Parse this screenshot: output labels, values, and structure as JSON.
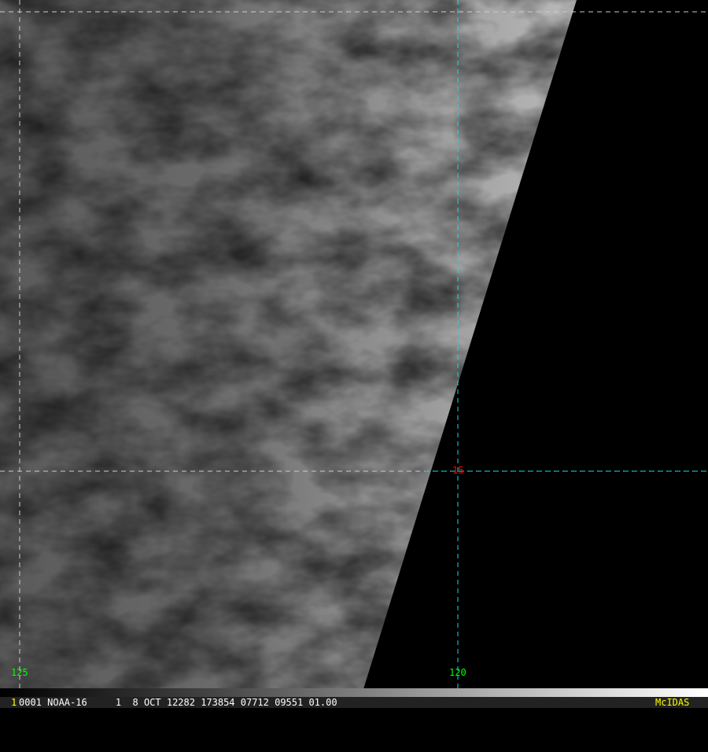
{
  "image": {
    "satellite_frame": "1",
    "header_text": "0001 NOAA-16     1  8 OCT 12282 173854 07712 09551 01.00",
    "brand": "McIDAS"
  },
  "grid_labels": {
    "lon_left": "125",
    "lon_right": "120",
    "lat": "15"
  },
  "colors": {
    "grid": "#00e5ee",
    "lon_label": "#00ff00",
    "lat_label": "#ff0000",
    "brand": "#ffff00"
  }
}
